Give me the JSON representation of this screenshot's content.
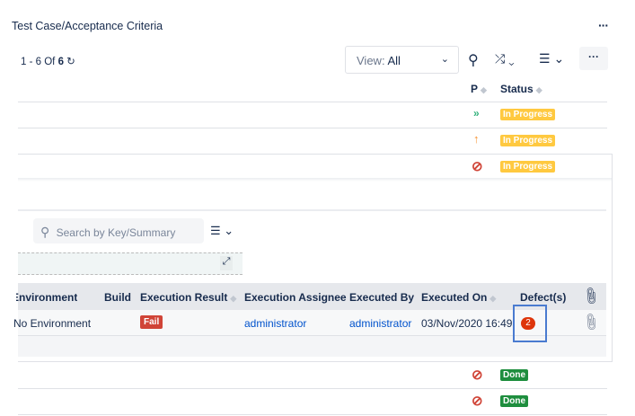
{
  "title": "Test Case/Acceptance Criteria",
  "pagination": {
    "range": "1 - 6",
    "of": "Of",
    "total": "6"
  },
  "view": {
    "label": "View:",
    "value": "All"
  },
  "columns": {
    "p": "P",
    "status": "Status"
  },
  "rows": [
    {
      "priority": "lowest",
      "status": "In Progress"
    },
    {
      "priority": "high",
      "status": "In Progress"
    },
    {
      "priority": "blocker",
      "status": "In Progress"
    },
    {
      "priority": "blocker",
      "status": "Done"
    },
    {
      "priority": "blocker",
      "status": "Done"
    }
  ],
  "execution": {
    "search_placeholder": "Search by Key/Summary",
    "headers": [
      "Environment",
      "Build",
      "Execution Result",
      "Execution Assignee",
      "Executed By",
      "Executed On",
      "Defect(s)"
    ],
    "row": {
      "environment": "No Environment",
      "build": "",
      "result": "Fail",
      "assignee": "administrator",
      "executed_by": "administrator",
      "executed_on": "03/Nov/2020 16:49",
      "defects": "2"
    }
  },
  "colors": {
    "in_progress": "#ffc940",
    "done": "#1e8e3e",
    "fail": "#de350b",
    "link": "#0052cc",
    "highlight": "#4a7bd0"
  }
}
